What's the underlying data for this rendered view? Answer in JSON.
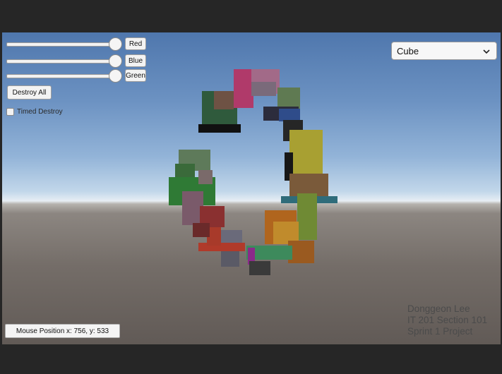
{
  "controls": {
    "sliders": [
      {
        "label": "Red",
        "value": 1.0
      },
      {
        "label": "Blue",
        "value": 1.0
      },
      {
        "label": "Green",
        "value": 1.0
      }
    ],
    "destroy_all_label": "Destroy All",
    "timed_destroy_label": "Timed Destroy",
    "timed_destroy_checked": false
  },
  "shape_dropdown": {
    "selected": "Cube",
    "icon": "chevron-down-icon"
  },
  "credit": {
    "line1": "Donggeon Lee",
    "line2": "IT 201 Section 101",
    "line3": "Sprint 1 Project"
  },
  "mouse_position": {
    "text": "Mouse Position x: 756, y: 533"
  },
  "colors": {
    "top_bar": "#262626",
    "credit_text": "#4b4b4b"
  }
}
